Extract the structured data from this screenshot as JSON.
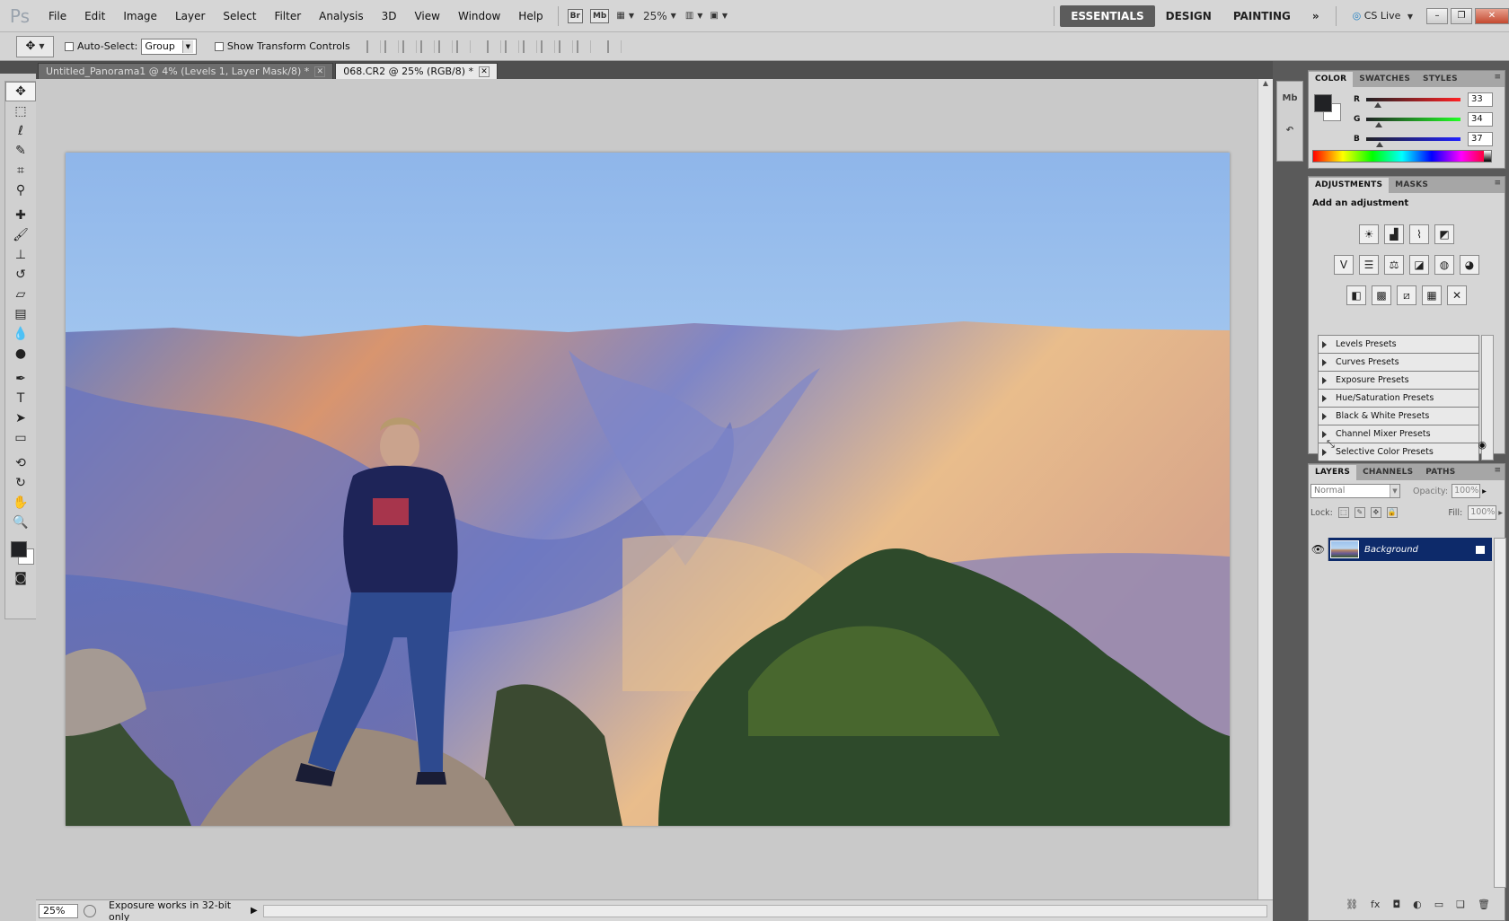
{
  "app": {
    "logo": "Ps"
  },
  "menu": [
    "File",
    "Edit",
    "Image",
    "Layer",
    "Select",
    "Filter",
    "Analysis",
    "3D",
    "View",
    "Window",
    "Help"
  ],
  "appbar": {
    "bridge": "Br",
    "minibridge": "Mb",
    "zoom": "25%"
  },
  "workspaces": {
    "items": [
      "ESSENTIALS",
      "DESIGN",
      "PAINTING"
    ],
    "active": "ESSENTIALS",
    "more": "»",
    "cslive": "CS Live"
  },
  "options": {
    "auto_select_label": "Auto-Select:",
    "auto_select_value": "Group",
    "transform_label": "Show Transform Controls"
  },
  "doc_tabs": [
    {
      "label": "Untitled_Panorama1 @ 4% (Levels 1, Layer Mask/8) *",
      "active": false
    },
    {
      "label": "068.CR2 @ 25% (RGB/8) *",
      "active": true
    }
  ],
  "status": {
    "zoom": "25%",
    "text": "Exposure works in 32-bit only"
  },
  "color_panel": {
    "tabs": [
      "COLOR",
      "SWATCHES",
      "STYLES"
    ],
    "foreground": "#212225",
    "channels": [
      {
        "label": "R",
        "value": "33",
        "color": "#d40000"
      },
      {
        "label": "G",
        "value": "34",
        "color": "#00a000"
      },
      {
        "label": "B",
        "value": "37",
        "color": "#0020d0"
      }
    ]
  },
  "adjustments_panel": {
    "tabs": [
      "ADJUSTMENTS",
      "MASKS"
    ],
    "title": "Add an adjustment",
    "icon_rows": [
      [
        "brightness-contrast-icon",
        "levels-icon",
        "curves-icon",
        "exposure-icon"
      ],
      [
        "vibrance-icon",
        "hue-saturation-icon",
        "color-balance-icon",
        "black-white-icon",
        "photo-filter-icon",
        "channel-mixer-icon"
      ],
      [
        "invert-icon",
        "posterize-icon",
        "threshold-icon",
        "gradient-map-icon",
        "selective-color-icon"
      ]
    ],
    "presets": [
      "Levels Presets",
      "Curves Presets",
      "Exposure Presets",
      "Hue/Saturation Presets",
      "Black & White Presets",
      "Channel Mixer Presets",
      "Selective Color Presets"
    ]
  },
  "layers_panel": {
    "tabs": [
      "LAYERS",
      "CHANNELS",
      "PATHS"
    ],
    "blend_mode": "Normal",
    "opacity_label": "Opacity:",
    "opacity": "100%",
    "lock_label": "Lock:",
    "fill_label": "Fill:",
    "fill": "100%",
    "layers": [
      {
        "name": "Background",
        "selected": true,
        "visible": true
      }
    ]
  }
}
